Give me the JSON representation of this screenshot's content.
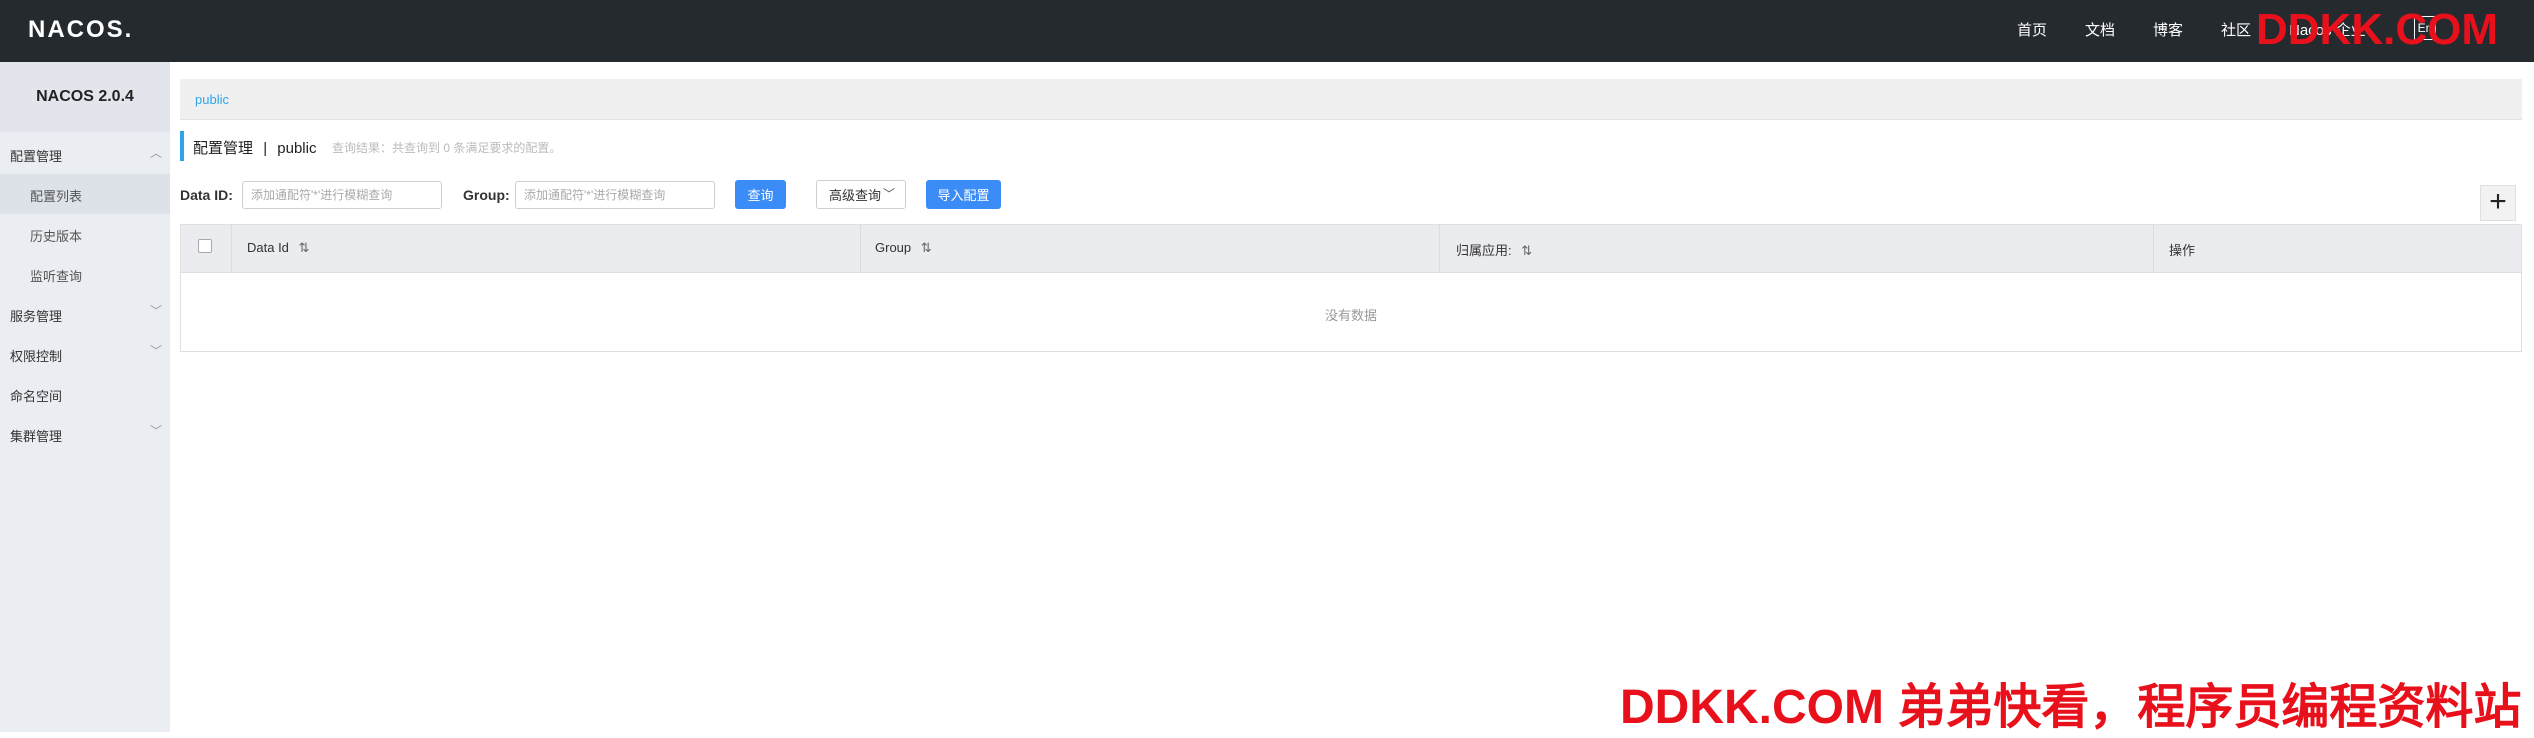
{
  "header": {
    "logo": "NACOS.",
    "nav": [
      "首页",
      "文档",
      "博客",
      "社区"
    ],
    "nav_truncated": "Nacos 企业",
    "lang_button": "En",
    "watermark": "DDKK.COM"
  },
  "sidebar": {
    "title": "NACOS 2.0.4",
    "items": [
      {
        "label": "配置管理",
        "expanded": true
      },
      {
        "label": "配置列表",
        "sub": true,
        "active": true
      },
      {
        "label": "历史版本",
        "sub": true
      },
      {
        "label": "监听查询",
        "sub": true
      },
      {
        "label": "服务管理",
        "expanded": false
      },
      {
        "label": "权限控制",
        "expanded": false
      },
      {
        "label": "命名空间"
      },
      {
        "label": "集群管理",
        "expanded": false
      }
    ]
  },
  "breadcrumb": {
    "namespace": "public"
  },
  "page": {
    "title": "配置管理",
    "separator": "|",
    "namespace": "public",
    "result_hint": "查询结果：共查询到 0 条满足要求的配置。"
  },
  "search": {
    "data_id_label": "Data ID:",
    "data_id_placeholder": "添加通配符'*'进行模糊查询",
    "group_label": "Group:",
    "group_placeholder": "添加通配符'*'进行模糊查询",
    "query_button": "查询",
    "advanced_button": "高级查询",
    "import_button": "导入配置",
    "add_button": "+"
  },
  "table": {
    "columns": [
      "Data Id",
      "Group",
      "归属应用:",
      "操作"
    ],
    "sort_icon": "⇅",
    "empty_text": "没有数据"
  },
  "watermark_bottom": "DDKK.COM 弟弟快看，程序员编程资料站",
  "colors": {
    "topbar": "#252a2f",
    "sidebar": "#eaedf1",
    "accent": "#2fa4e7",
    "primary_button": "#3c8cf7",
    "watermark": "#e8111b"
  }
}
